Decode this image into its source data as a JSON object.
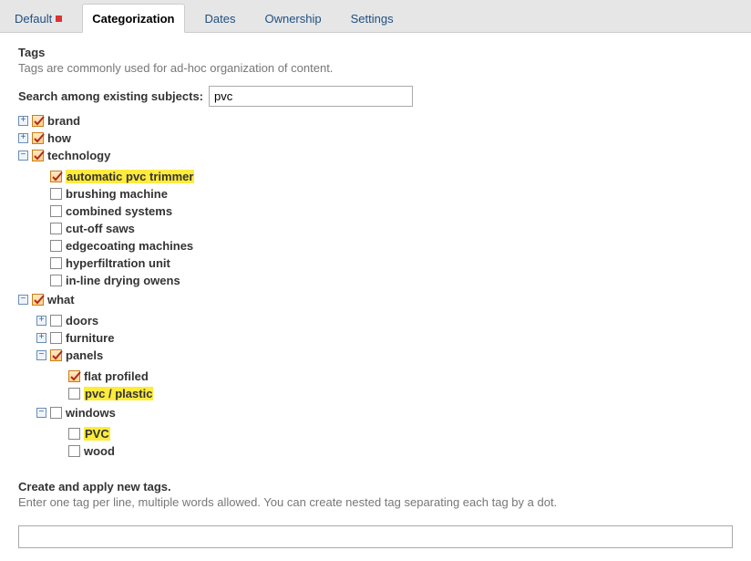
{
  "tabs": {
    "default": "Default",
    "categorization": "Categorization",
    "dates": "Dates",
    "ownership": "Ownership",
    "settings": "Settings"
  },
  "section": {
    "title": "Tags",
    "desc": "Tags are commonly used for ad-hoc organization of content."
  },
  "search": {
    "label": "Search among existing subjects:",
    "value": "pvc"
  },
  "tree": {
    "brand": "brand",
    "how": "how",
    "technology": {
      "label": "technology",
      "children": {
        "automatic_pvc_trimmer": "automatic pvc trimmer",
        "brushing_machine": "brushing machine",
        "combined_systems": "combined systems",
        "cut_off_saws": "cut-off saws",
        "edgecoating_machines": "edgecoating machines",
        "hyperfiltration_unit": "hyperfiltration unit",
        "inline_drying_owens": "in-line drying owens"
      }
    },
    "what": {
      "label": "what",
      "children": {
        "doors": "doors",
        "furniture": "furniture",
        "panels": {
          "label": "panels",
          "children": {
            "flat_profiled": "flat profiled",
            "pvc_plastic": "pvc / plastic"
          }
        },
        "windows": {
          "label": "windows",
          "children": {
            "pvc": "PVC",
            "wood": "wood"
          }
        }
      }
    }
  },
  "create": {
    "title": "Create and apply new tags.",
    "desc": "Enter one tag per line, multiple words allowed. You can create nested tag separating each tag by a dot."
  }
}
